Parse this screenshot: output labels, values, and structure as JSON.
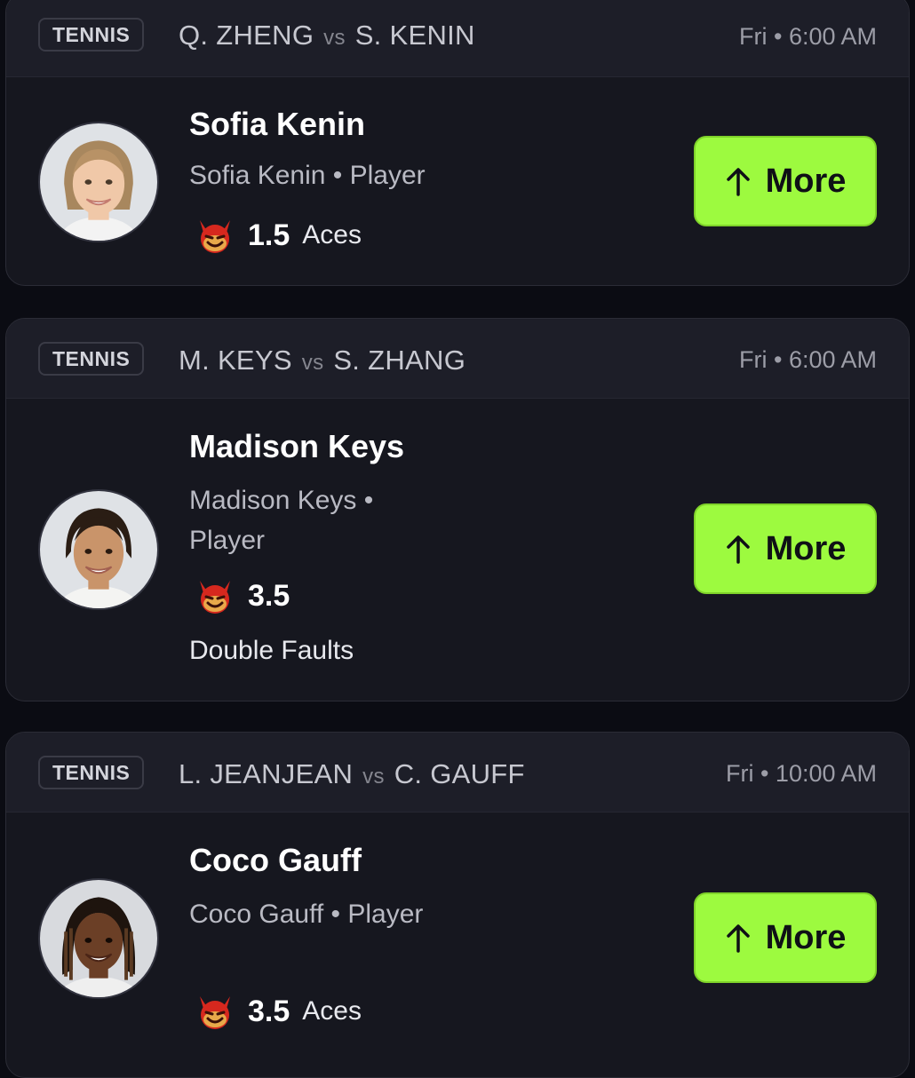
{
  "cards": [
    {
      "sport": "TENNIS",
      "player_a": "Q. ZHENG",
      "vs": "vs",
      "player_b": "S. KENIN",
      "time": "Fri • 6:00 AM",
      "name": "Sofia Kenin",
      "subtitle": "Sofia Kenin • Player",
      "stat_value": "1.5",
      "stat_label": "Aces",
      "button_label": "More",
      "icon": "devil-icon"
    },
    {
      "sport": "TENNIS",
      "player_a": "M. KEYS",
      "vs": "vs",
      "player_b": "S. ZHANG",
      "time": "Fri • 6:00 AM",
      "name": "Madison Keys",
      "subtitle_line1": "Madison Keys •",
      "subtitle_line2": "Player",
      "stat_value": "3.5",
      "stat_label": "Double Faults",
      "button_label": "More",
      "icon": "devil-icon"
    },
    {
      "sport": "TENNIS",
      "player_a": "L. JEANJEAN",
      "vs": "vs",
      "player_b": "C. GAUFF",
      "time": "Fri • 10:00 AM",
      "name": "Coco Gauff",
      "subtitle": "Coco Gauff • Player",
      "stat_value": "3.5",
      "stat_label": "Aces",
      "button_label": "More",
      "icon": "devil-icon"
    }
  ],
  "colors": {
    "accent": "#9dfa3f",
    "card_bg": "#16171f",
    "header_bg": "#1d1e28",
    "page_bg": "#0b0c13"
  }
}
